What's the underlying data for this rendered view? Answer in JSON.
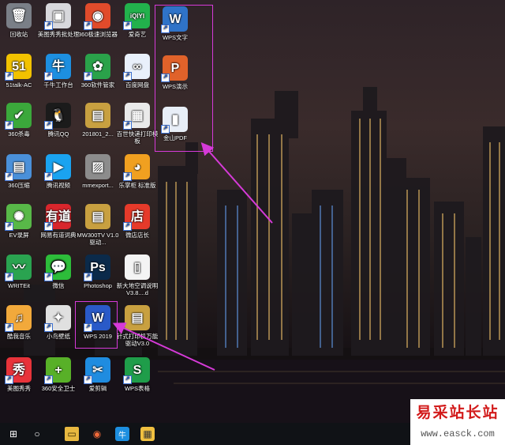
{
  "desktop": {
    "icons": [
      {
        "id": "recycle",
        "label": "回收站",
        "glyph": "🗑",
        "bg": "#7a7f87",
        "shortcut": false
      },
      {
        "id": "meitu-batch",
        "label": "美图秀秀批处理",
        "glyph": "▣",
        "bg": "#d8d8dc",
        "shortcut": true
      },
      {
        "id": "360browser",
        "label": "360极速浏览器",
        "glyph": "◉",
        "bg": "#e04b2b",
        "shortcut": true
      },
      {
        "id": "iqiyi",
        "label": "爱奇艺",
        "glyph": "iQIYI",
        "bg": "#22b14c",
        "shortcut": true
      },
      {
        "id": "wps-writer",
        "label": "WPS文字",
        "glyph": "W",
        "bg": "#2f73c8",
        "shortcut": true
      },
      {
        "id": "51talk",
        "label": "51talk-AC",
        "glyph": "51",
        "bg": "#f2c200",
        "shortcut": true
      },
      {
        "id": "qianniu",
        "label": "千牛工作台",
        "glyph": "牛",
        "bg": "#1d8fe0",
        "shortcut": true
      },
      {
        "id": "360soft",
        "label": "360软件管家",
        "glyph": "✿",
        "bg": "#2aa24a",
        "shortcut": true
      },
      {
        "id": "baidupan",
        "label": "百度网盘",
        "glyph": "∞",
        "bg": "#e9f0fb",
        "shortcut": true
      },
      {
        "id": "wps-ppt",
        "label": "WPS演示",
        "glyph": "P",
        "bg": "#e0622a",
        "shortcut": true
      },
      {
        "id": "360av",
        "label": "360杀毒",
        "glyph": "✔",
        "bg": "#3ba83b",
        "shortcut": true
      },
      {
        "id": "tencentqq",
        "label": "腾讯QQ",
        "glyph": "🐧",
        "bg": "#1b1b1b",
        "shortcut": true
      },
      {
        "id": "zip201801",
        "label": "201801_2...",
        "glyph": "▤",
        "bg": "#c8a040",
        "shortcut": false
      },
      {
        "id": "baishi",
        "label": "百世快递打印模板",
        "glyph": "▦",
        "bg": "#eaeaea",
        "shortcut": true
      },
      {
        "id": "jinshanpdf",
        "label": "金山PDF",
        "glyph": "▮",
        "bg": "#e8eef7",
        "shortcut": true
      },
      {
        "id": "360zip",
        "label": "360压缩",
        "glyph": "▤",
        "bg": "#4a90d9",
        "shortcut": true
      },
      {
        "id": "tencentvideo",
        "label": "腾讯视频",
        "glyph": "▶",
        "bg": "#1aa3f0",
        "shortcut": true
      },
      {
        "id": "mmexport",
        "label": "mmexport...",
        "glyph": "▨",
        "bg": "#8c8c8c",
        "shortcut": false
      },
      {
        "id": "lezhanggui",
        "label": "乐掌柜 标准版",
        "glyph": "◕",
        "bg": "#f0a020",
        "shortcut": true
      },
      {
        "id": "evrecord",
        "label": "EV录屏",
        "glyph": "✺",
        "bg": "#58b848",
        "shortcut": true
      },
      {
        "id": "youdao",
        "label": "网易有道词典",
        "glyph": "有道",
        "bg": "#d8262c",
        "shortcut": true
      },
      {
        "id": "mw300tv",
        "label": "MW300TV V1.0驱动...",
        "glyph": "▤",
        "bg": "#c8a040",
        "shortcut": false
      },
      {
        "id": "weishop",
        "label": "微店店长",
        "glyph": "店",
        "bg": "#e63a2a",
        "shortcut": true
      },
      {
        "id": "writeit",
        "label": "WRITEit",
        "glyph": "〰",
        "bg": "#2aa350",
        "shortcut": true
      },
      {
        "id": "wechat",
        "label": "微信",
        "glyph": "💬",
        "bg": "#2dbd3a",
        "shortcut": true
      },
      {
        "id": "photoshop",
        "label": "Photoshop",
        "glyph": "Ps",
        "bg": "#0b2a4a",
        "shortcut": true
      },
      {
        "id": "newdoc",
        "label": "新大地空调说明V3.8....d",
        "glyph": "▯",
        "bg": "#f4f4f4",
        "shortcut": false
      },
      {
        "id": "kugou",
        "label": "酷我音乐",
        "glyph": "♫",
        "bg": "#f2a93b",
        "shortcut": true
      },
      {
        "id": "xiaoniao",
        "label": "小鸟壁纸",
        "glyph": "✦",
        "bg": "#e0e0e0",
        "shortcut": true
      },
      {
        "id": "wps2019",
        "label": "WPS 2019",
        "glyph": "W",
        "bg": "#2a5ac8",
        "shortcut": true
      },
      {
        "id": "printdriver",
        "label": "针式打印机万能驱动V3.0",
        "glyph": "▤",
        "bg": "#c8a040",
        "shortcut": false
      },
      {
        "id": "meituxiuxiu",
        "label": "美图秀秀",
        "glyph": "秀",
        "bg": "#e8333a",
        "shortcut": true
      },
      {
        "id": "360guard",
        "label": "360安全卫士",
        "glyph": "+",
        "bg": "#58b028",
        "shortcut": true
      },
      {
        "id": "aijianji",
        "label": "爱剪辑",
        "glyph": "✂",
        "bg": "#1f8ce0",
        "shortcut": true
      },
      {
        "id": "wps-sheet",
        "label": "WPS表格",
        "glyph": "S",
        "bg": "#1f9d4a",
        "shortcut": true
      }
    ]
  },
  "taskbar": {
    "items": [
      {
        "id": "start",
        "glyph": "⊞"
      },
      {
        "id": "cortana",
        "glyph": "○"
      },
      {
        "id": "explorer",
        "glyph": "▭"
      },
      {
        "id": "chrome-like",
        "glyph": "◉"
      },
      {
        "id": "qianniu-tb",
        "glyph": "牛"
      },
      {
        "id": "app-tb",
        "glyph": "▦"
      }
    ]
  },
  "watermark": {
    "title": "易采站长站",
    "url": "www.easck.com"
  },
  "colors": {
    "highlight": "#d63ad8"
  }
}
